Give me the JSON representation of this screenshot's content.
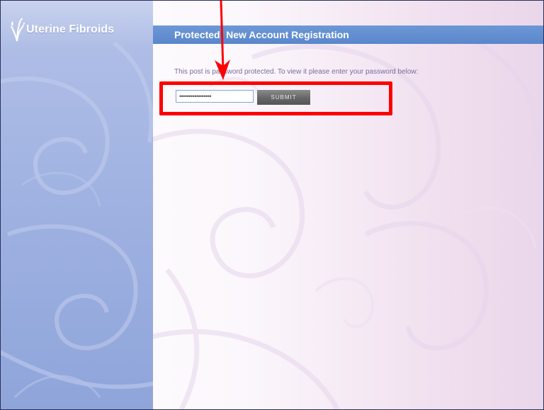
{
  "site": {
    "logo_text": "Uterine Fibroids",
    "logo_icon": "leaf-icon"
  },
  "header": {
    "title": "Protected: New Account Registration"
  },
  "content": {
    "protected_message": "This post is password protected. To view it please enter your password below:",
    "password_value": "•••••••••••••••••",
    "submit_label": "SUBMIT"
  },
  "annotation": {
    "arrow_icon": "arrow-down-icon",
    "highlight_color": "#ff0000"
  },
  "colors": {
    "title_bar": "#5a86cb",
    "sidebar": "#9db0e0",
    "message_text": "#7c6a9c",
    "submit_button": "#666666"
  }
}
